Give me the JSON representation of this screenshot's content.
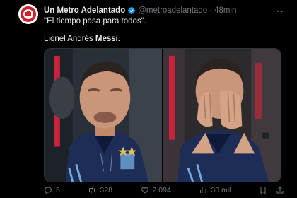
{
  "tweet": {
    "display_name": "Un Metro Adelantado",
    "handle": "@metroadelantado",
    "separator": "·",
    "time": "48min",
    "more": "···",
    "text_line1": "\"El tiempo pasa para todos\".",
    "text_line2_prefix": "Lionel Andrés ",
    "text_line2_bold": "Messi.",
    "replies": "5",
    "retweets": "328",
    "likes": "2.094",
    "views": "30 mil"
  },
  "colors": {
    "background": "#000000",
    "text": "#e7e9ea",
    "muted": "#71767b",
    "verified": "#1d9bf0",
    "avatar_red": "#d0202a"
  }
}
